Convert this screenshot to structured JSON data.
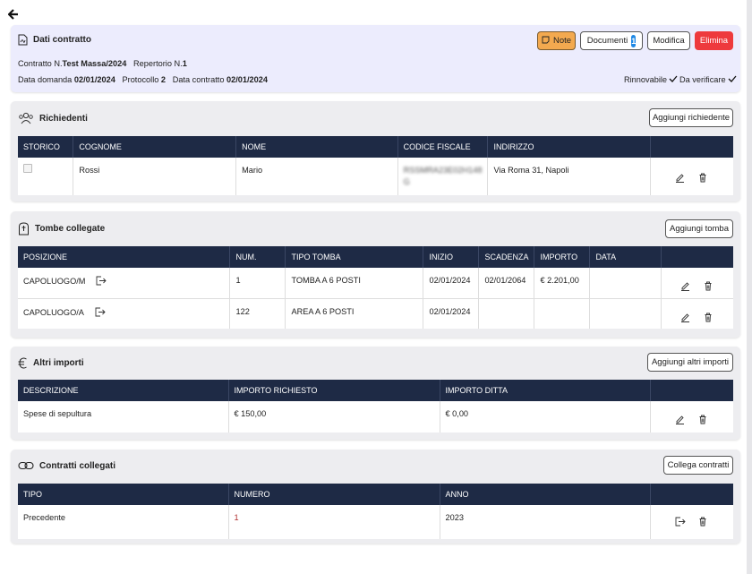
{
  "header": {
    "title": "Dati contratto",
    "buttons": {
      "note": "Note",
      "documenti": "Documenti",
      "documenti_count": "1",
      "modifica": "Modifica",
      "elimina": "Elimina"
    },
    "line1": {
      "contratto_label": "Contratto N.",
      "contratto_value": "Test Massa/2024",
      "repertorio_label": "Repertorio N.",
      "repertorio_value": "1"
    },
    "line2": {
      "data_domanda_label": "Data domanda",
      "data_domanda_value": "02/01/2024",
      "protocollo_label": "Protocollo",
      "protocollo_value": "2",
      "data_contratto_label": "Data contratto",
      "data_contratto_value": "02/01/2024"
    },
    "flags": {
      "rinnovabile": "Rinnovabile",
      "da_verificare": "Da verificare"
    }
  },
  "richiedenti": {
    "title": "Richiedenti",
    "add_button": "Aggiungi richiedente",
    "columns": [
      "STORICO",
      "COGNOME",
      "NOME",
      "CODICE FISCALE",
      "INDIRIZZO"
    ],
    "rows": [
      {
        "cognome": "Rossi",
        "nome": "Mario",
        "codice_fiscale_1": "RSSMRA23E02H148",
        "codice_fiscale_2": "G",
        "indirizzo": "Via Roma 31, Napoli"
      }
    ]
  },
  "tombe": {
    "title": "Tombe collegate",
    "add_button": "Aggiungi tomba",
    "columns": [
      "POSIZIONE",
      "NUM.",
      "TIPO TOMBA",
      "INIZIO",
      "SCADENZA",
      "IMPORTO",
      "DATA"
    ],
    "rows": [
      {
        "posizione": "CAPOLUOGO/M",
        "num": "1",
        "tipo": "TOMBA A 6 POSTI",
        "inizio": "02/01/2024",
        "scadenza": "02/01/2064",
        "importo": "€ 2.201,00",
        "data": ""
      },
      {
        "posizione": "CAPOLUOGO/A",
        "num": "122",
        "tipo": "AREA A 6 POSTI",
        "inizio": "02/01/2024",
        "scadenza": "",
        "importo": "",
        "data": ""
      }
    ]
  },
  "altri_importi": {
    "title": "Altri importi",
    "add_button": "Aggiungi altri importi",
    "columns": [
      "DESCRIZIONE",
      "IMPORTO RICHIESTO",
      "IMPORTO DITTA"
    ],
    "rows": [
      {
        "descrizione": "Spese di sepultura",
        "richiesto": "€ 150,00",
        "ditta": "€ 0,00"
      }
    ]
  },
  "contratti_collegati": {
    "title": "Contratti collegati",
    "add_button": "Collega contratti",
    "columns": [
      "TIPO",
      "NUMERO",
      "ANNO"
    ],
    "rows": [
      {
        "tipo": "Precedente",
        "numero": "1",
        "anno": "2023"
      }
    ]
  },
  "colors": {
    "table_header": "#1e2a45",
    "header_card": "#ececfd",
    "note_button": "#f3a94f",
    "danger_button": "#ee3a3d",
    "badge": "#1e88e5"
  }
}
